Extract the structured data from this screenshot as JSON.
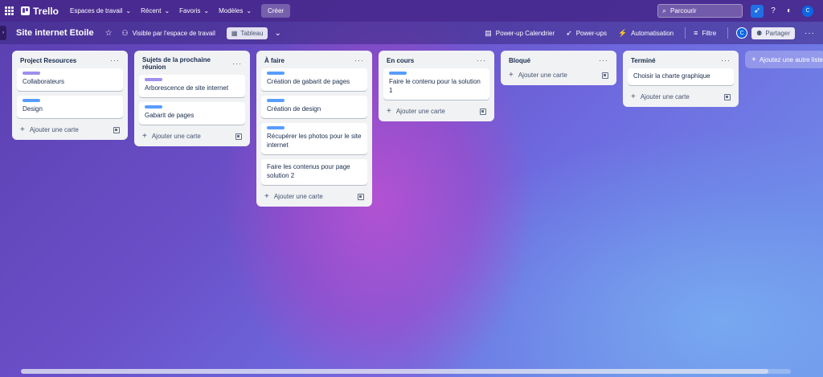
{
  "topbar": {
    "app_name": "Trello",
    "nav": [
      {
        "label": "Espaces de travail"
      },
      {
        "label": "Récent"
      },
      {
        "label": "Favoris"
      },
      {
        "label": "Modèles"
      }
    ],
    "create_label": "Créer",
    "search_placeholder": "Parcourir",
    "avatar_initial": "C"
  },
  "boardbar": {
    "title": "Site internet Etoile",
    "visibility_label": "Visible par l'espace de travail",
    "view_label": "Tableau",
    "calendar_label": "Power-up Calendrier",
    "powerups_label": "Power-ups",
    "automation_label": "Automatisation",
    "filter_label": "Filtre",
    "member_initial": "C",
    "share_label": "Partager"
  },
  "colors": {
    "label_purple": "#9f8fef",
    "label_blue": "#579dff"
  },
  "lists": [
    {
      "title": "Project Resources",
      "cards": [
        {
          "title": "Collaborateurs",
          "label_color": "purple"
        },
        {
          "title": "Design",
          "label_color": "blue"
        }
      ],
      "add_label": "Ajouter une carte"
    },
    {
      "title": "Sujets de la prochaine réunion",
      "cards": [
        {
          "title": "Arborescence de site internet",
          "label_color": "purple"
        },
        {
          "title": "Gabarit de pages",
          "label_color": "blue"
        }
      ],
      "add_label": "Ajouter une carte"
    },
    {
      "title": "À faire",
      "cards": [
        {
          "title": "Création de gabarit de pages",
          "label_color": "blue"
        },
        {
          "title": "Création de design",
          "label_color": "blue"
        },
        {
          "title": "Récupérer les photos pour le site internet",
          "label_color": "blue"
        },
        {
          "title": "Faire les contenus pour page solution 2",
          "label_color": ""
        }
      ],
      "add_label": "Ajouter une carte"
    },
    {
      "title": "En cours",
      "cards": [
        {
          "title": "Faire le contenu pour la solution 1",
          "label_color": "blue"
        }
      ],
      "add_label": "Ajouter une carte"
    },
    {
      "title": "Bloqué",
      "cards": [],
      "add_label": "Ajouter une carte"
    },
    {
      "title": "Terminé",
      "cards": [
        {
          "title": "Choisir la charte graphique",
          "label_color": ""
        }
      ],
      "add_label": "Ajouter une carte"
    }
  ],
  "add_list_label": "Ajoutez une autre liste"
}
